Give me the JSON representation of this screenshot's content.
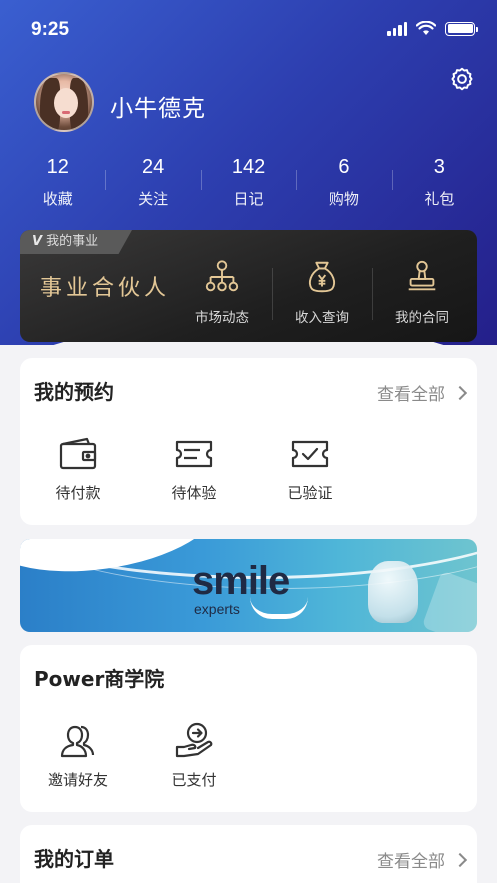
{
  "status_bar": {
    "time": "9:25"
  },
  "profile": {
    "name": "小牛德克"
  },
  "stats": [
    {
      "value": "12",
      "label": "收藏"
    },
    {
      "value": "24",
      "label": "关注"
    },
    {
      "value": "142",
      "label": "日记"
    },
    {
      "value": "6",
      "label": "购物"
    },
    {
      "value": "3",
      "label": "礼包"
    }
  ],
  "career": {
    "tag": "我的事业",
    "tag_mark": "V",
    "title": "事业合伙人",
    "items": [
      {
        "label": "市场动态",
        "icon": "org-chart-icon"
      },
      {
        "label": "收入查询",
        "icon": "money-bag-icon"
      },
      {
        "label": "我的合同",
        "icon": "stamp-icon"
      }
    ]
  },
  "appointments": {
    "title": "我的预约",
    "more": "查看全部",
    "items": [
      {
        "label": "待付款",
        "icon": "wallet-icon"
      },
      {
        "label": "待体验",
        "icon": "ticket-icon"
      },
      {
        "label": "已验证",
        "icon": "verified-ticket-icon"
      }
    ]
  },
  "banner": {
    "brand": "smile",
    "brand_sub": "experts"
  },
  "academy": {
    "title": "Power商学院",
    "items": [
      {
        "label": "邀请好友",
        "icon": "invite-friends-icon"
      },
      {
        "label": "已支付",
        "icon": "paid-icon"
      }
    ]
  },
  "orders": {
    "title": "我的订单",
    "more": "查看全部"
  },
  "colors": {
    "header_start": "#3a5fd0",
    "header_end": "#241f8a",
    "gold": "#e3c796",
    "page_bg": "#f3f3f6"
  }
}
